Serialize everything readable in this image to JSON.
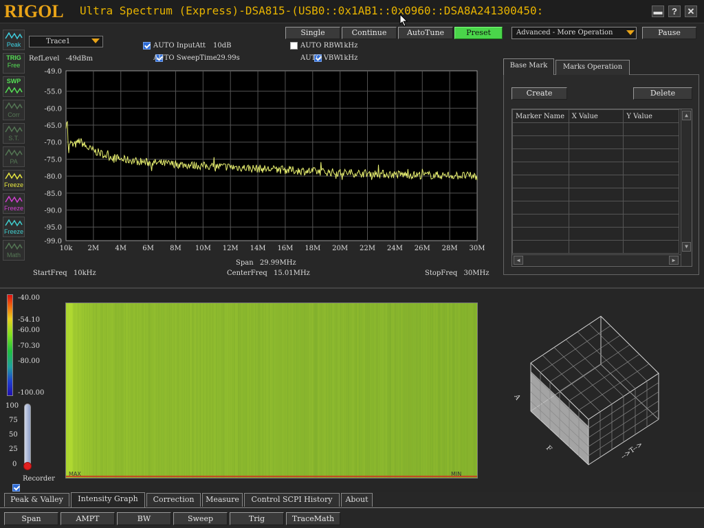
{
  "titlebar": {
    "logo": "RIGOL",
    "title": "Ultra Spectrum (Express)-DSA815-(USB0::0x1AB1::0x0960::DSA8A241300450:",
    "minimize": "▬",
    "help": "?",
    "close": "✕"
  },
  "toolbar": {
    "trace_select": "Trace1",
    "single": "Single",
    "continue": "Continue",
    "autotune": "AutoTune",
    "preset": "Preset",
    "advanced": "Advanced - More Operation",
    "pause": "Pause"
  },
  "settings": {
    "ref_level_label": "RefLevel",
    "ref_level": "-49dBm",
    "auto_input_att_label": "AUTO InputAtt",
    "auto_input_att_value": "10dB",
    "auto_input_att_checked": true,
    "auto_sweep_time_label": "AUTO SweepTime",
    "auto_sweep_time_value": "29.99s",
    "auto_sweep_time_checked": true,
    "auto_rbw_label": "AUTO RBW",
    "auto_rbw_value": "1kHz",
    "auto_rbw_checked": false,
    "auto_vbw_label": "AUTO VBW",
    "auto_vbw_value": "1kHz",
    "auto_vbw_checked": true
  },
  "side_tools": [
    {
      "top": "",
      "label": "Peak",
      "icon": "peak-icon",
      "color": "#3fd0e0"
    },
    {
      "top": "TRIG",
      "label": "Free",
      "icon": "trig-icon",
      "color": "#55e055"
    },
    {
      "top": "SWP",
      "label": "",
      "icon": "sweep-icon",
      "color": "#55e055"
    },
    {
      "top": "",
      "label": "Corr",
      "icon": "corr-icon",
      "color": "#557755"
    },
    {
      "top": "",
      "label": "S.T.",
      "icon": "st-icon",
      "color": "#557755"
    },
    {
      "top": "",
      "label": "PA",
      "icon": "pa-icon",
      "color": "#557755"
    },
    {
      "top": "",
      "label": "Freeze",
      "icon": "freeze-yellow-icon",
      "color": "#e8e840"
    },
    {
      "top": "",
      "label": "Freeze",
      "icon": "freeze-magenta-icon",
      "color": "#d040d0"
    },
    {
      "top": "",
      "label": "Freeze",
      "icon": "freeze-cyan-icon",
      "color": "#40d0d0"
    },
    {
      "top": "",
      "label": "Math",
      "icon": "math-icon",
      "color": "#557755"
    }
  ],
  "chart_data": {
    "type": "line",
    "title": "",
    "xlabel": "",
    "ylabel": "",
    "xlim": [
      0.01,
      30
    ],
    "ylim": [
      -99.0,
      -49.0
    ],
    "x_ticks": [
      "10k",
      "2M",
      "4M",
      "6M",
      "8M",
      "10M",
      "12M",
      "14M",
      "16M",
      "18M",
      "20M",
      "22M",
      "24M",
      "26M",
      "28M",
      "30M"
    ],
    "y_ticks": [
      "-49.0",
      "-55.0",
      "-60.0",
      "-65.0",
      "-70.0",
      "-75.0",
      "-80.0",
      "-85.0",
      "-90.0",
      "-95.0",
      "-99.0"
    ],
    "y_tick_values": [
      -49.0,
      -55.0,
      -60.0,
      -65.0,
      -70.0,
      -75.0,
      -80.0,
      -85.0,
      -90.0,
      -95.0,
      -99.0
    ],
    "grid": true,
    "series": [
      {
        "color": "#e8f070",
        "x_unit": "MHz",
        "x": [
          0.01,
          0.1,
          0.2,
          0.3,
          0.5,
          0.8,
          1.0,
          1.5,
          2.0,
          3.0,
          4.0,
          5.0,
          6.0,
          8.0,
          10.0,
          12.0,
          14.0,
          16.0,
          18.0,
          20.0,
          22.0,
          24.0,
          26.0,
          28.0,
          30.0
        ],
        "values": [
          -66.0,
          -63.0,
          -73.0,
          -70.0,
          -71.0,
          -70.5,
          -69.5,
          -71.5,
          -72.5,
          -74.0,
          -75.0,
          -75.5,
          -76.0,
          -76.5,
          -77.0,
          -77.3,
          -77.8,
          -78.2,
          -78.6,
          -79.0,
          -79.2,
          -79.5,
          -79.7,
          -79.8,
          -80.0
        ]
      }
    ]
  },
  "freq": {
    "start_label": "StartFreq",
    "start": "10kHz",
    "center_label": "CenterFreq",
    "center": "15.01MHz",
    "stop_label": "StopFreq",
    "stop": "30MHz",
    "span_label": "Span",
    "span": "29.99MHz"
  },
  "markers": {
    "tabs": [
      "Base Mark",
      "Marks Operation"
    ],
    "create": "Create",
    "delete": "Delete",
    "columns": [
      "Marker Name",
      "X Value",
      "Y Value"
    ],
    "empty_rows": 10
  },
  "intensity": {
    "scale_labels": [
      "-40.00",
      "-54.10",
      "-60.00",
      "-70.30",
      "-80.00",
      "-100.00"
    ],
    "thermo_labels": [
      "100",
      "75",
      "50",
      "25",
      "0"
    ],
    "recorder_label": "Recorder",
    "recorder_checked": true,
    "max_label": "MAX",
    "min_label": "MIN",
    "axis_f": "F",
    "axis_t": "-->T-->",
    "axis_a": "A"
  },
  "bottom_tabs": [
    "Peak & Valley",
    "Intensity Graph",
    "Correction",
    "Measure",
    "Control SCPI History",
    "About"
  ],
  "selected_bottom_tab": "Intensity Graph",
  "function_buttons": [
    "Span",
    "AMPT",
    "BW",
    "Sweep",
    "Trig",
    "TraceMath"
  ]
}
